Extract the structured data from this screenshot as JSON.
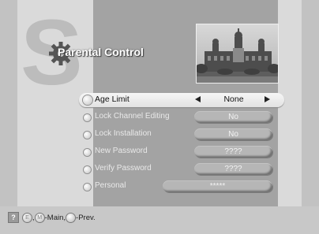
{
  "screen": {
    "title": "Parental Control",
    "logo_letter": "S"
  },
  "menu": {
    "items": [
      {
        "label": "Age Limit",
        "value": "None",
        "selected": true
      },
      {
        "label": "Lock Channel Editing",
        "value": "No",
        "selected": false
      },
      {
        "label": "Lock Installation",
        "value": "No",
        "selected": false
      },
      {
        "label": "New Password",
        "value": "????",
        "selected": false
      },
      {
        "label": "Verify Password",
        "value": "????",
        "selected": false
      },
      {
        "label": "Personal",
        "value": "*****",
        "selected": false
      }
    ]
  },
  "footer": {
    "help_glyph": "?",
    "exit_glyph": "E",
    "sep": ",",
    "menu_glyph": "M",
    "main_label": "-Main,",
    "prev_label": "-Prev."
  },
  "colors": {
    "center_panel": "#a3a3a3",
    "side_panel": "#dadada",
    "highlight": "#f0f0f0"
  }
}
